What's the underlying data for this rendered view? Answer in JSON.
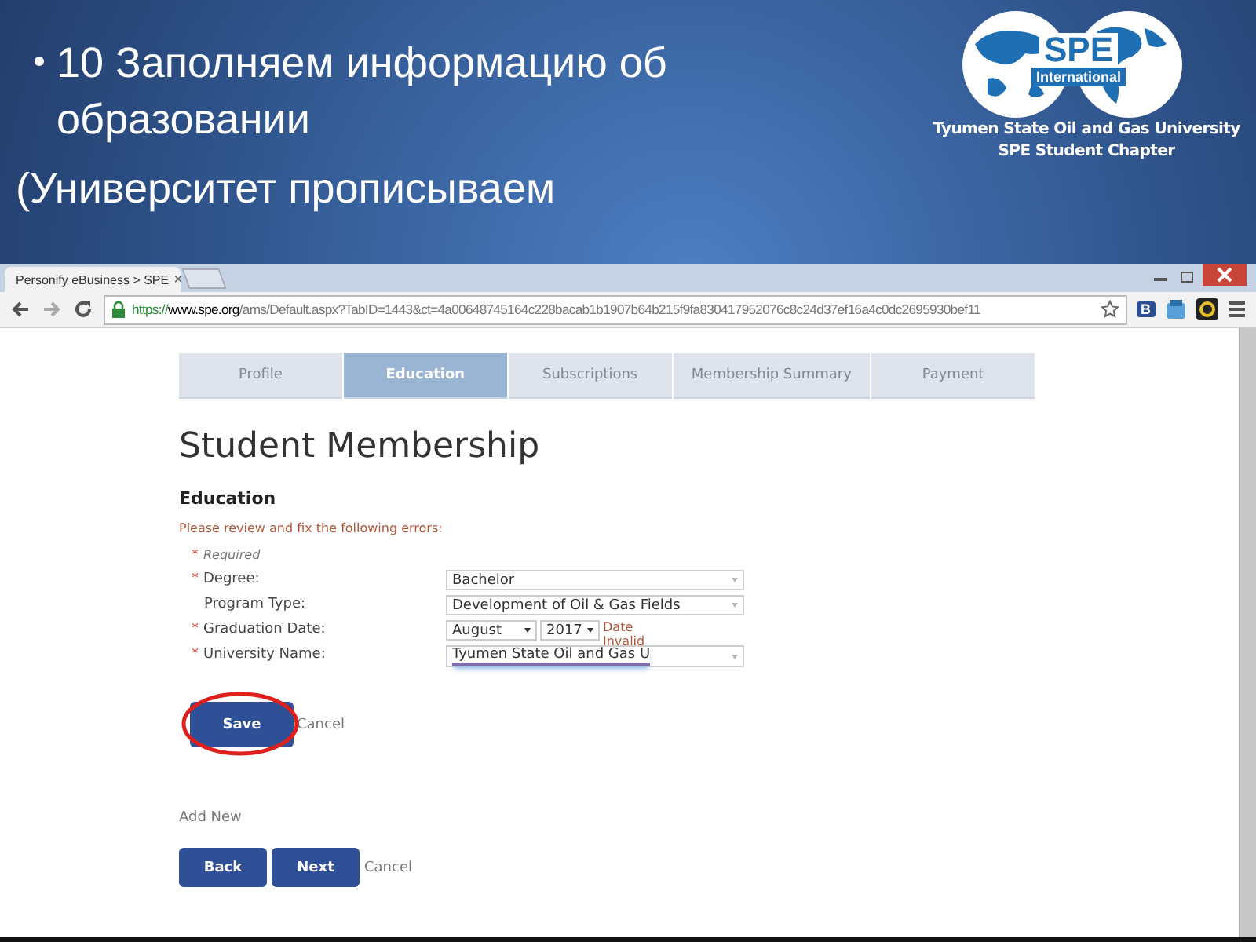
{
  "slide": {
    "bullet": "10 Заполняем информацию об образовании",
    "note": "(Университет прописываем"
  },
  "logo": {
    "mark": "SPE",
    "sub": "International",
    "lines": [
      "Tyumen State Oil and Gas University",
      "SPE Student Chapter"
    ]
  },
  "browser": {
    "tab_title": "Personify eBusiness > SPE",
    "tab_close": "×",
    "url_scheme": "https://",
    "url_host": "www.spe.org",
    "url_path": "/ams/Default.aspx?TabID=1443&ct=4a00648745164c228bacab1b1907b64b215f9fa830417952076c8c24d37ef16a4c0dc2695930bef11",
    "ext_label": "B"
  },
  "steps": [
    {
      "label": "Profile",
      "selected": false
    },
    {
      "label": "Education",
      "selected": true
    },
    {
      "label": "Subscriptions",
      "selected": false
    },
    {
      "label": "Membership Summary",
      "selected": false
    },
    {
      "label": "Payment",
      "selected": false
    }
  ],
  "page": {
    "title": "Student Membership",
    "section": "Education",
    "error": "Please review and fix the following errors:",
    "required_mark": "*",
    "required_note": "Required"
  },
  "fields": [
    {
      "label": "Degree:",
      "required": true,
      "kind": "select",
      "value": "Bachelor"
    },
    {
      "label": "Program Type:",
      "required": false,
      "kind": "select",
      "value": "Development of Oil & Gas Fields"
    },
    {
      "label": "Graduation Date:",
      "required": true,
      "kind": "date",
      "month": "August",
      "year": "2017",
      "error": "Date Invalid"
    },
    {
      "label": "University Name:",
      "required": true,
      "kind": "combo",
      "value": "Tyumen State Oil and Gas U"
    }
  ],
  "save": "Save",
  "save_cancel": "Cancel",
  "add_new": "Add New",
  "nav": {
    "back": "Back",
    "next": "Next",
    "cancel": "Cancel"
  }
}
